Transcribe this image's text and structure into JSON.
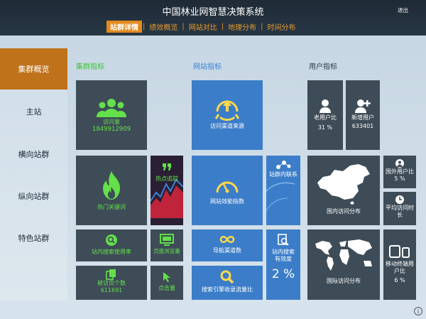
{
  "app": {
    "title": "中国林业网智慧决策系统",
    "exit_label": "退出"
  },
  "tabs": [
    {
      "label": "站群详情",
      "active": true
    },
    {
      "label": "绩效概览"
    },
    {
      "label": "网站对比"
    },
    {
      "label": "地理分布"
    },
    {
      "label": "时间分布"
    }
  ],
  "tab_separator": "|",
  "sidebar": {
    "items": [
      {
        "label": "集群概览",
        "active": true
      },
      {
        "label": "主站"
      },
      {
        "label": "横向站群"
      },
      {
        "label": "纵向站群"
      },
      {
        "label": "特色站群"
      }
    ]
  },
  "sections": {
    "cluster": "集群指标",
    "site": "网站指标",
    "user": "用户指标"
  },
  "cluster": {
    "visits_label": "访问量",
    "visits_value": "1849912909",
    "hot_keywords": "热门关键词",
    "hot_tracking": "热点追踪",
    "search_rate": "站内搜索使用率",
    "page_stay": "页面浏览量",
    "pages_label": "被访页个数",
    "pages_value": "611691",
    "clicks": "点击量"
  },
  "site": {
    "channel_source": "访问渠道来源",
    "site_efficiency": "网站效能指数",
    "site_link": "站群内联系",
    "nav_channel": "导航渠道数",
    "search_effect_label": "站内搜索有效度",
    "search_effect_value": "2 %",
    "search_engine": "搜索引擎收录流量比"
  },
  "user": {
    "old_ratio_label": "老用户比",
    "old_ratio_value": "31 %",
    "new_users_label": "新增用户",
    "new_users_value": "633401",
    "domestic": "国内访问分布",
    "foreign_ratio_label": "国外用户比",
    "foreign_ratio_value": "5 %",
    "avg_time": "平均访问时长",
    "international": "国际访问分布",
    "mobile_ratio_label": "移动终端用户比",
    "mobile_ratio_value": "6 %"
  },
  "colors": {
    "topbar": "#1e2a35",
    "accent_orange": "#e38a1c",
    "active_side": "#c0721a",
    "tile_dark": "#3e4c57",
    "tile_blue": "#3b7dc9",
    "green": "#63e04a"
  },
  "info_icon": "i"
}
